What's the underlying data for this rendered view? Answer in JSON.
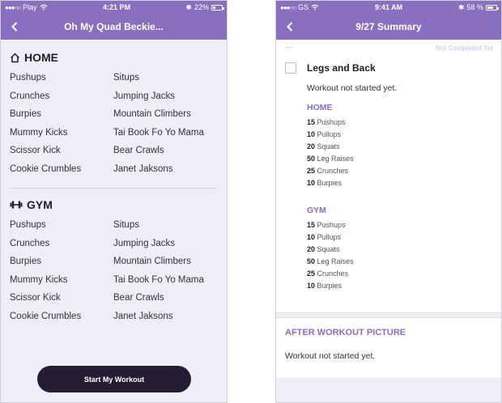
{
  "left_screen": {
    "status": {
      "carrier": "Play",
      "time": "4:21 PM",
      "battery": "22%",
      "battery_level": 0.22
    },
    "nav": {
      "title": "Oh My Quad Beckie..."
    },
    "home": {
      "title": "HOME",
      "exercises": [
        "Pushups",
        "Situps",
        "Crunches",
        "Jumping Jacks",
        "Burpies",
        "Mountain Climbers",
        "Mummy Kicks",
        "Tai Book Fo Yo Mama",
        "Scissor Kick",
        "Bear Crawls",
        "Cookie Crumbles",
        "Janet Jaksons"
      ]
    },
    "gym": {
      "title": "GYM",
      "exercises": [
        "Pushups",
        "Situps",
        "Crunches",
        "Jumping Jacks",
        "Burpies",
        "Mountain Climbers",
        "Mummy Kicks",
        "Tai Book Fo Yo Mama",
        "Scissor Kick",
        "Bear Crawls",
        "Cookie Crumbles",
        "Janet Jaksons"
      ]
    },
    "start_button": "Start My Workout"
  },
  "right_screen": {
    "status": {
      "carrier": "GS",
      "time": "9:41 AM",
      "battery": "58 %",
      "battery_level": 0.58
    },
    "nav": {
      "title": "9/27 Summary"
    },
    "dash": "—",
    "status_label": "Not Completed Yet",
    "workout": {
      "title": "Legs and Back",
      "status_text": "Workout not started yet.",
      "groups": [
        {
          "title": "HOME",
          "items": [
            {
              "count": "15",
              "name": "Pushups"
            },
            {
              "count": "10",
              "name": "Pullups"
            },
            {
              "count": "20",
              "name": "Squats"
            },
            {
              "count": "50",
              "name": "Leg Raises"
            },
            {
              "count": "25",
              "name": "Crunches"
            },
            {
              "count": "10",
              "name": "Burpies"
            }
          ]
        },
        {
          "title": "GYM",
          "items": [
            {
              "count": "15",
              "name": "Pushups"
            },
            {
              "count": "10",
              "name": "Pullups"
            },
            {
              "count": "20",
              "name": "Squats"
            },
            {
              "count": "50",
              "name": "Leg Raises"
            },
            {
              "count": "25",
              "name": "Crunches"
            },
            {
              "count": "10",
              "name": "Burpies"
            }
          ]
        }
      ]
    },
    "after_picture": {
      "title": "AFTER WORKOUT PICTURE",
      "text": "Workout not started yet."
    }
  },
  "colors": {
    "accent": "#8a6ec0",
    "background": "#efedf7",
    "button": "#241d33"
  },
  "icons": [
    "back-chevron-icon",
    "home-icon",
    "dumbbell-icon",
    "wifi-icon",
    "bluetooth-icon",
    "battery-icon",
    "checkbox"
  ]
}
